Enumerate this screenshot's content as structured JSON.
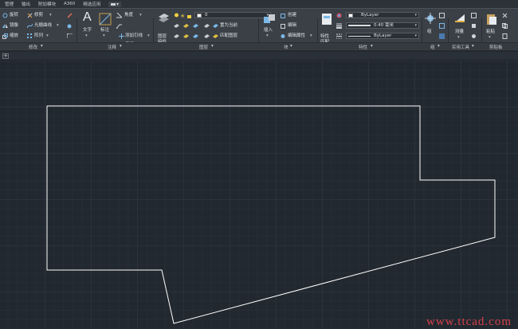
{
  "menu": {
    "tabs": [
      "管理",
      "输出",
      "附加模块",
      "A360",
      "精选应用"
    ]
  },
  "ribbon": {
    "modify": {
      "title": "修改",
      "items": [
        "旋转",
        "修剪",
        "镜像",
        "光顺曲线",
        "缩放",
        "阵列"
      ]
    },
    "annotation": {
      "title": "注释",
      "text_label": "文字",
      "dim_label": "标注",
      "items": [
        "角度",
        "引线",
        "添加引线",
        "表格"
      ]
    },
    "layers": {
      "title": "图层",
      "props_label": "图层特性",
      "layer_value": "0",
      "items": [
        "置为当前",
        "匹配图层"
      ]
    },
    "block": {
      "title": "块",
      "insert_label": "插入",
      "items": [
        "创建",
        "编辑",
        "编辑属性"
      ]
    },
    "properties": {
      "title": "特性",
      "match_label": "特性匹配",
      "color_value": "ByLayer",
      "lineweight_value": "0.40 毫米",
      "linetype_value": "ByLayer"
    },
    "groups": {
      "title": "组",
      "label": "组"
    },
    "utilities": {
      "title": "实用工具",
      "label": "测量"
    },
    "clipboard": {
      "title": "剪贴板",
      "label": "粘贴"
    }
  },
  "drawing": {
    "outline_color": "#ffffff"
  },
  "watermark": "www.ttcad.com"
}
